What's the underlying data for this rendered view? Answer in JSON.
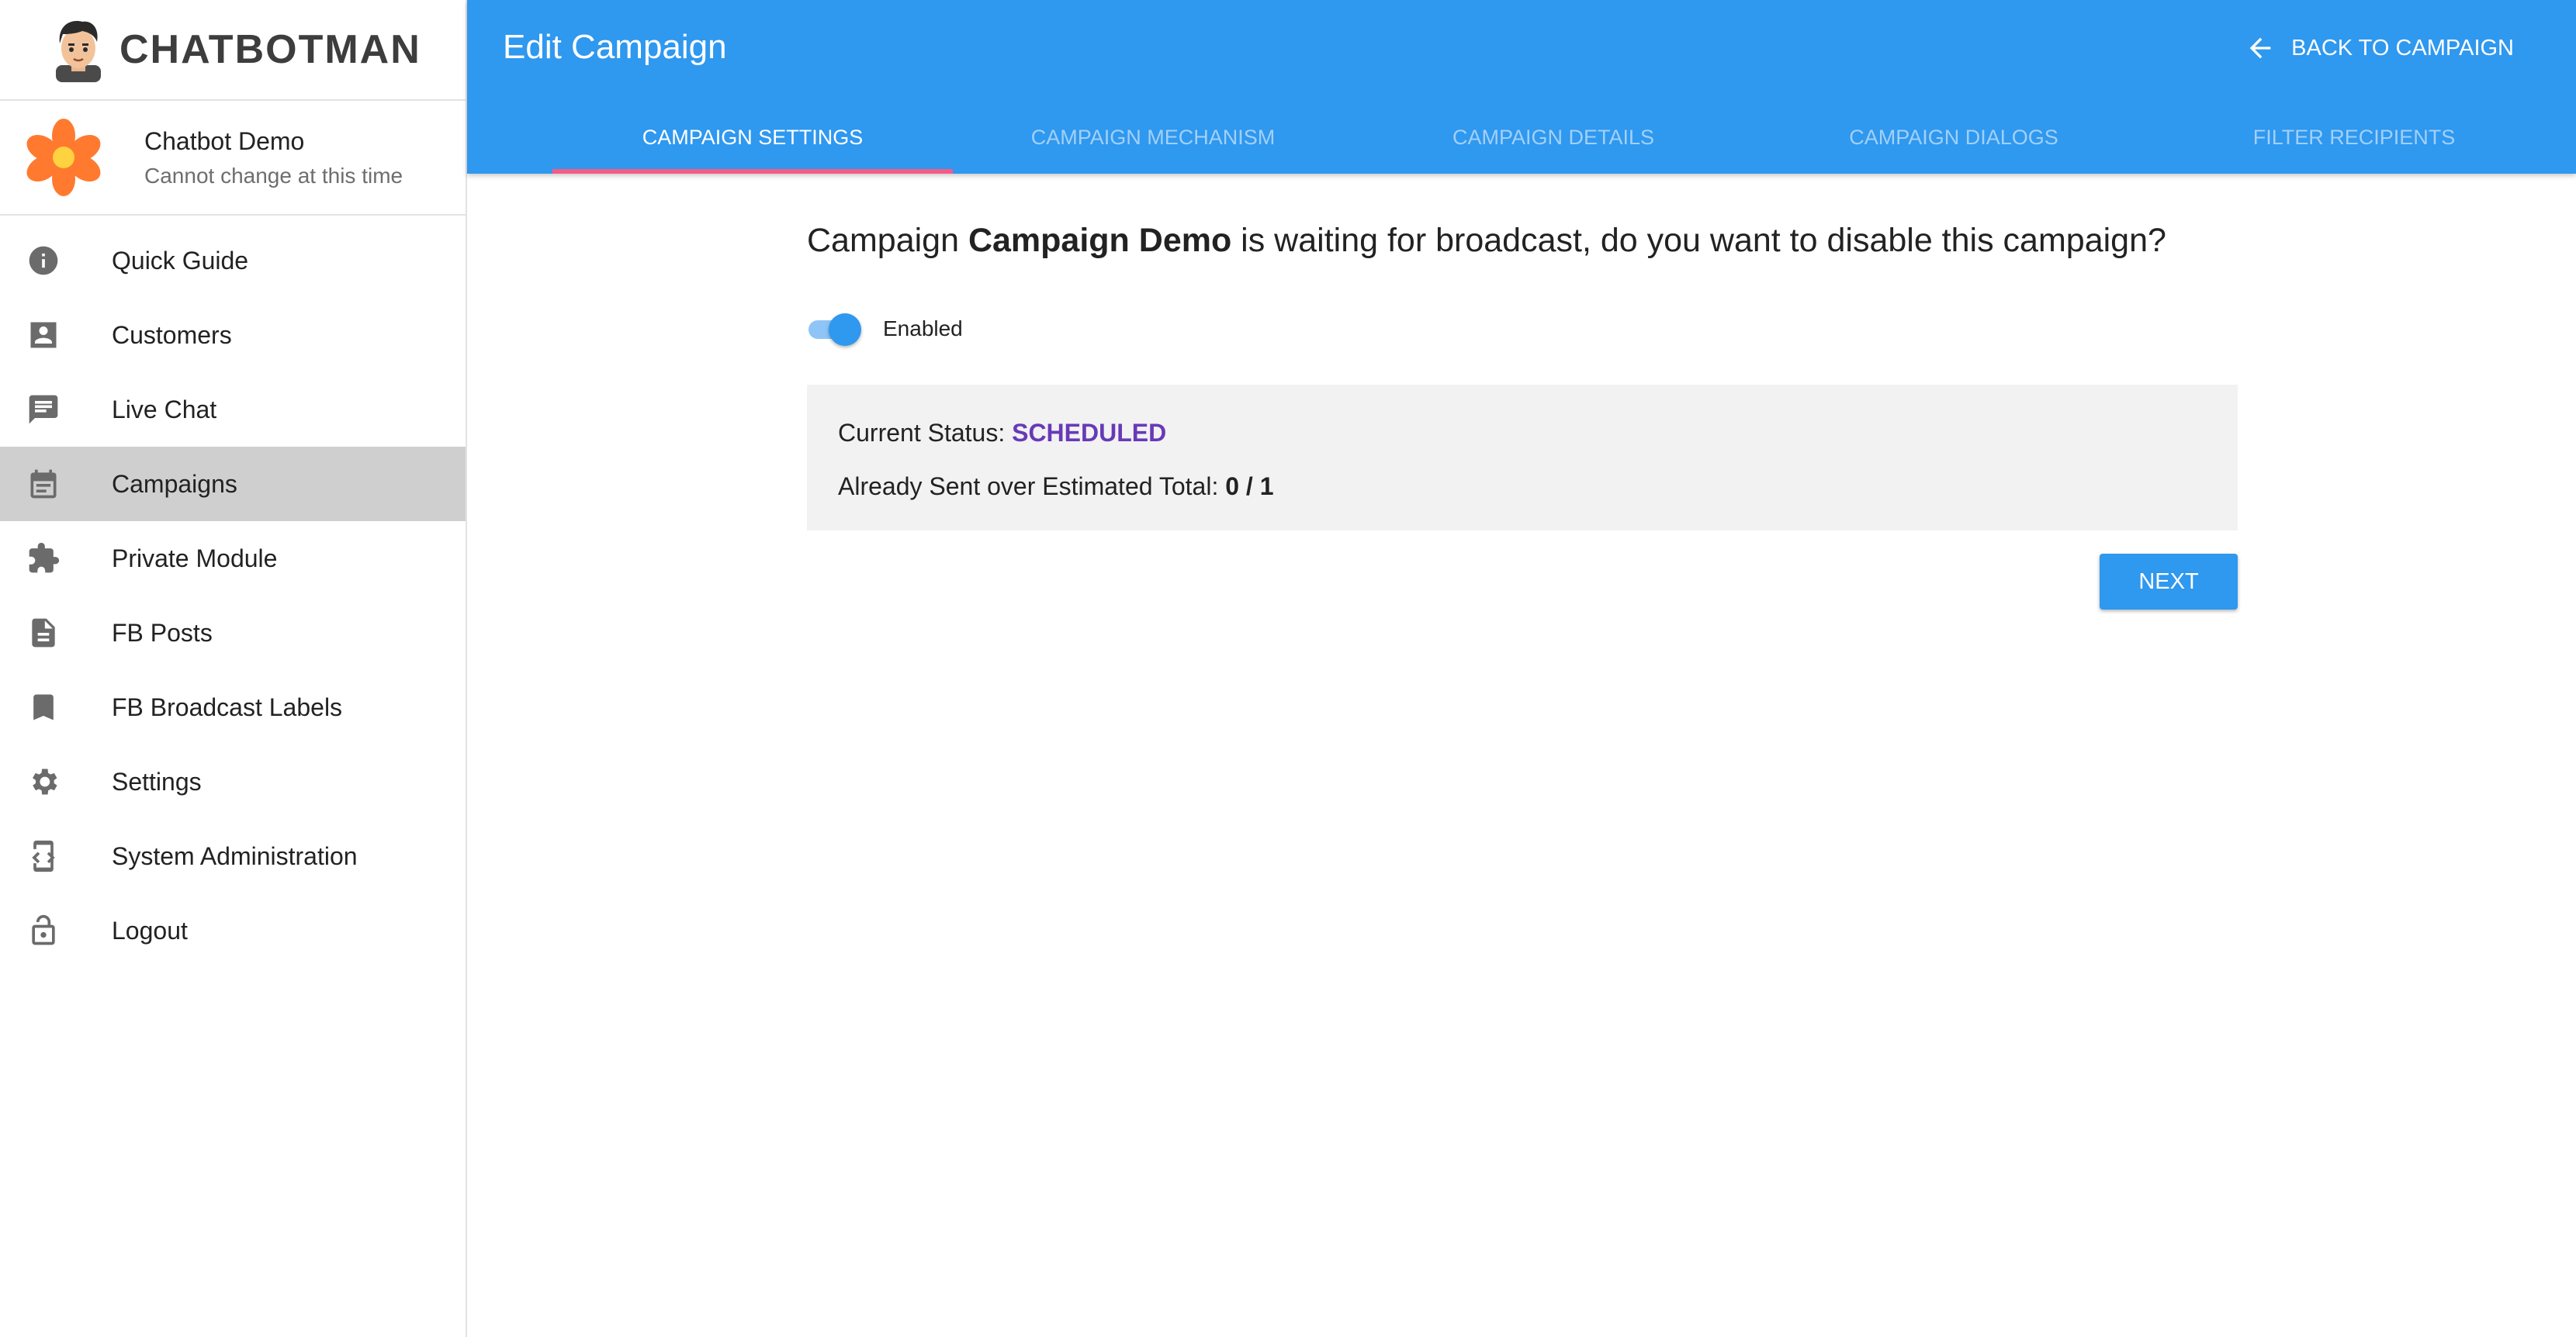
{
  "brand": {
    "name": "CHATBOTMAN",
    "logo_icon": "chatbotman-face-icon"
  },
  "bot": {
    "name": "Chatbot Demo",
    "subtitle": "Cannot change at this time",
    "avatar_icon": "flower-icon"
  },
  "nav": [
    {
      "label": "Quick Guide",
      "icon": "info-icon"
    },
    {
      "label": "Customers",
      "icon": "contact-card-icon"
    },
    {
      "label": "Live Chat",
      "icon": "chat-icon"
    },
    {
      "label": "Campaigns",
      "icon": "calendar-icon",
      "active": true
    },
    {
      "label": "Private Module",
      "icon": "puzzle-icon"
    },
    {
      "label": "FB Posts",
      "icon": "document-icon"
    },
    {
      "label": "FB Broadcast Labels",
      "icon": "bookmark-icon"
    },
    {
      "label": "Settings",
      "icon": "gear-icon"
    },
    {
      "label": "System Administration",
      "icon": "developer-icon"
    },
    {
      "label": "Logout",
      "icon": "lock-open-icon"
    }
  ],
  "header": {
    "title": "Edit Campaign",
    "back_label": "BACK TO CAMPAIGN",
    "tabs": [
      {
        "label": "CAMPAIGN SETTINGS",
        "active": true
      },
      {
        "label": "CAMPAIGN MECHANISM"
      },
      {
        "label": "CAMPAIGN DETAILS"
      },
      {
        "label": "CAMPAIGN DIALOGS"
      },
      {
        "label": "FILTER RECIPIENTS"
      }
    ]
  },
  "main": {
    "question_prefix": "Campaign ",
    "campaign_name": "Campaign Demo",
    "question_suffix": " is waiting for broadcast, do you want to disable this campaign?",
    "toggle_label": "Enabled",
    "toggle_on": true,
    "status_label": "Current Status: ",
    "status_value": "SCHEDULED",
    "sent_label": "Already Sent over Estimated Total: ",
    "sent_value": "0 / 1",
    "next_label": "NEXT"
  },
  "colors": {
    "primary": "#2f98ef",
    "tab_indicator": "#f45b86",
    "status": "#673ab7",
    "active_nav": "#cfcfcf"
  }
}
